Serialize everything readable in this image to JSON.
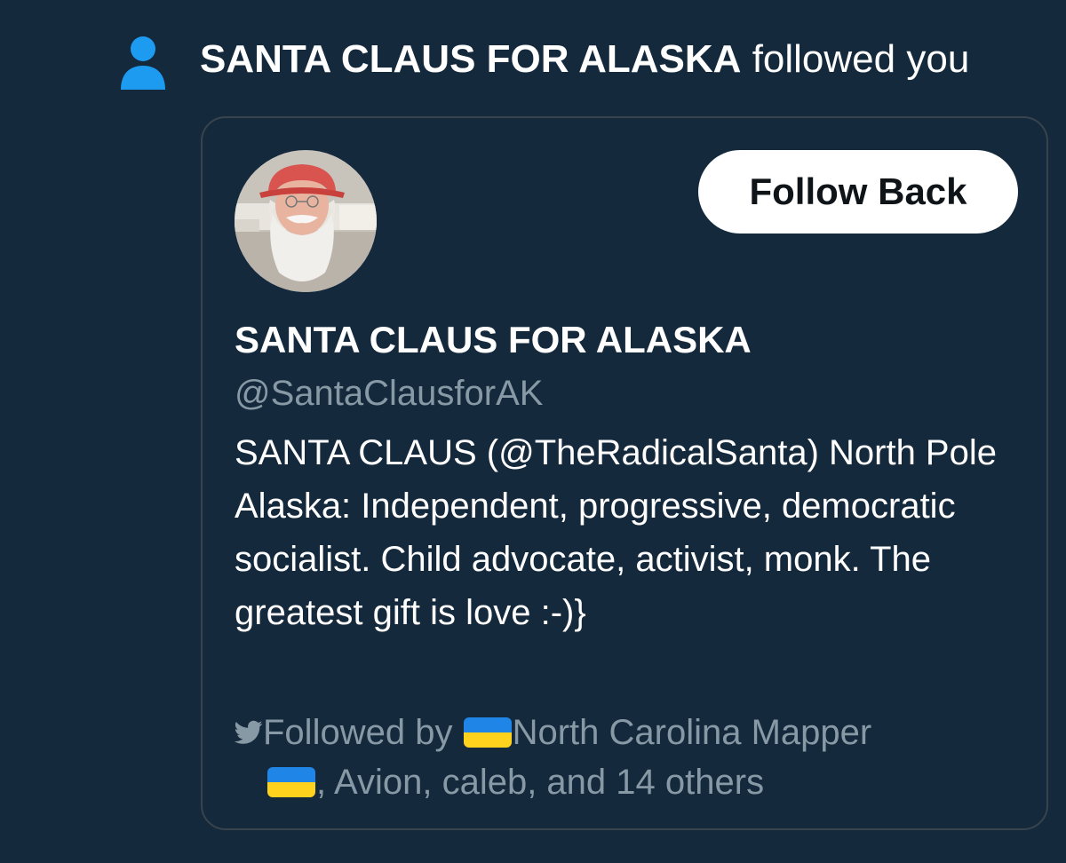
{
  "notification": {
    "icon": "person-icon",
    "account_name": "SANTA CLAUS FOR ALASKA",
    "action_text": "followed you",
    "icon_color": "#1d9bf0"
  },
  "card": {
    "follow_button_label": "Follow Back",
    "display_name": "SANTA CLAUS FOR ALASKA",
    "handle": "@SantaClausforAK",
    "bio": "SANTA CLAUS (@TheRadicalSanta) North Pole Alaska: Independent, progressive, democratic socialist. Child advocate, activist, monk. The greatest gift is love :-)}",
    "followed_by": {
      "icon": "twitter-bird-icon",
      "prefix": "Followed by",
      "name_first": "North Carolina Mapper",
      "flag": "ukraine-flag-icon",
      "rest": ", Avion, caleb, and 14 others"
    }
  },
  "colors": {
    "background": "#15293d",
    "card_border": "#38444d",
    "secondary_text": "#8899a6",
    "button_bg": "#ffffff",
    "button_text": "#0f1419"
  }
}
